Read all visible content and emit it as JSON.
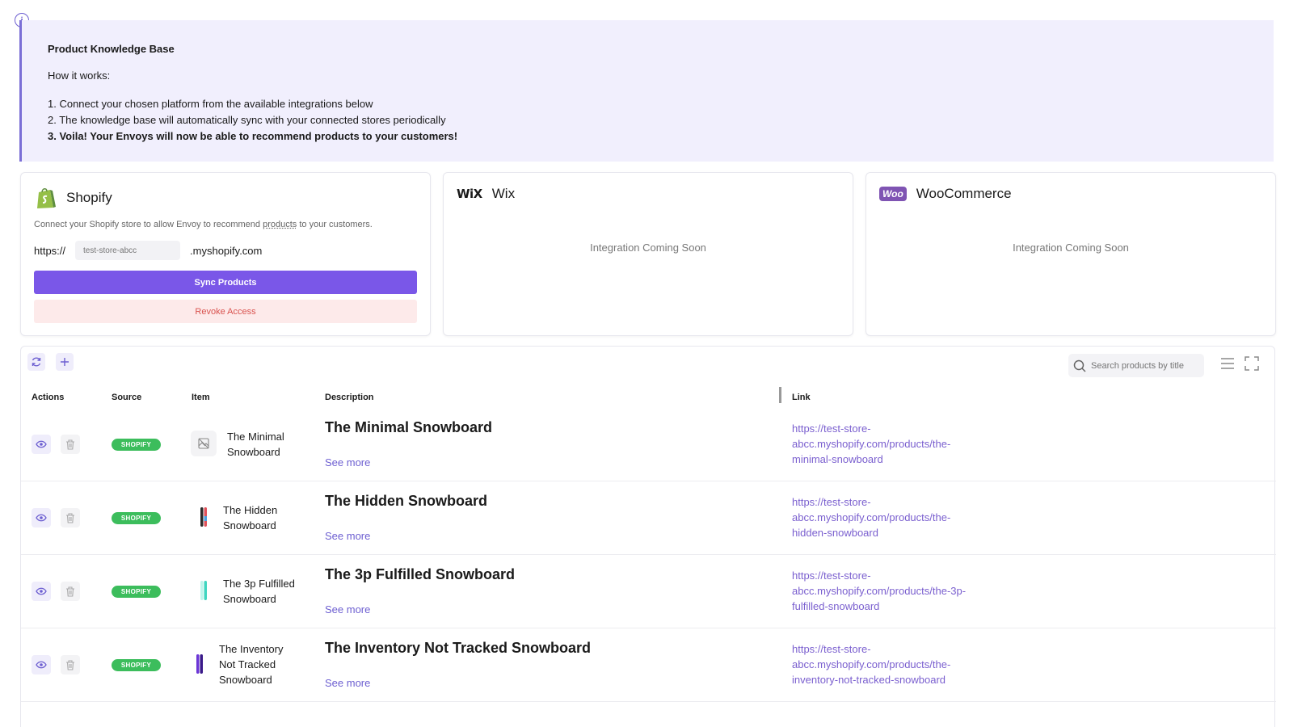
{
  "banner": {
    "title": "Product Knowledge Base",
    "subtitle": "How it works:",
    "steps": [
      "1. Connect your chosen platform from the available integrations below",
      "2. The knowledge base will automatically sync with your connected stores periodically",
      "3. Voila! Your Envoys will now be able to recommend products to your customers!"
    ]
  },
  "integrations": {
    "shopify": {
      "name": "Shopify",
      "description_before": "Connect your Shopify store to allow Envoy to recommend ",
      "description_link": "products",
      "description_after": " to your customers.",
      "url_prefix": "https://",
      "store_placeholder": "test-store-abcc",
      "url_suffix": ".myshopify.com",
      "sync_label": "Sync Products",
      "revoke_label": "Revoke Access"
    },
    "wix": {
      "logo_text": "WiX",
      "name": "Wix",
      "status": "Integration Coming Soon"
    },
    "woocommerce": {
      "logo_text": "Woo",
      "name": "WooCommerce",
      "status": "Integration Coming Soon"
    }
  },
  "table": {
    "search_placeholder": "Search products by title",
    "columns": {
      "actions": "Actions",
      "source": "Source",
      "item": "Item",
      "description": "Description",
      "link": "Link"
    },
    "rows": [
      {
        "source": "SHOPIFY",
        "item": "The Minimal Snowboard",
        "description_title": "The Minimal Snowboard",
        "see_more": "See more",
        "link": "https://test-store-abcc.myshopify.com/products/the-minimal-snowboard",
        "thumb": "placeholder"
      },
      {
        "source": "SHOPIFY",
        "item": "The Hidden Snowboard",
        "description_title": "The Hidden Snowboard",
        "see_more": "See more",
        "link": "https://test-store-abcc.myshopify.com/products/the-hidden-snowboard",
        "thumb": "#e0525b"
      },
      {
        "source": "SHOPIFY",
        "item": "The 3p Fulfilled Snowboard",
        "description_title": "The 3p Fulfilled Snowboard",
        "see_more": "See more",
        "link": "https://test-store-abcc.myshopify.com/products/the-3p-fulfilled-snowboard",
        "thumb": "#3fd6c0"
      },
      {
        "source": "SHOPIFY",
        "item": "The Inventory Not Tracked Snowboard",
        "description_title": "The Inventory Not Tracked Snowboard",
        "see_more": "See more",
        "link": "https://test-store-abcc.myshopify.com/products/the-inventory-not-tracked-snowboard",
        "thumb": "#6b35d6"
      }
    ]
  },
  "colors": {
    "accent": "#7a57e8",
    "badge": "#3cbd5c",
    "link": "#7a5fcf",
    "banner_bg": "#f1effd"
  }
}
